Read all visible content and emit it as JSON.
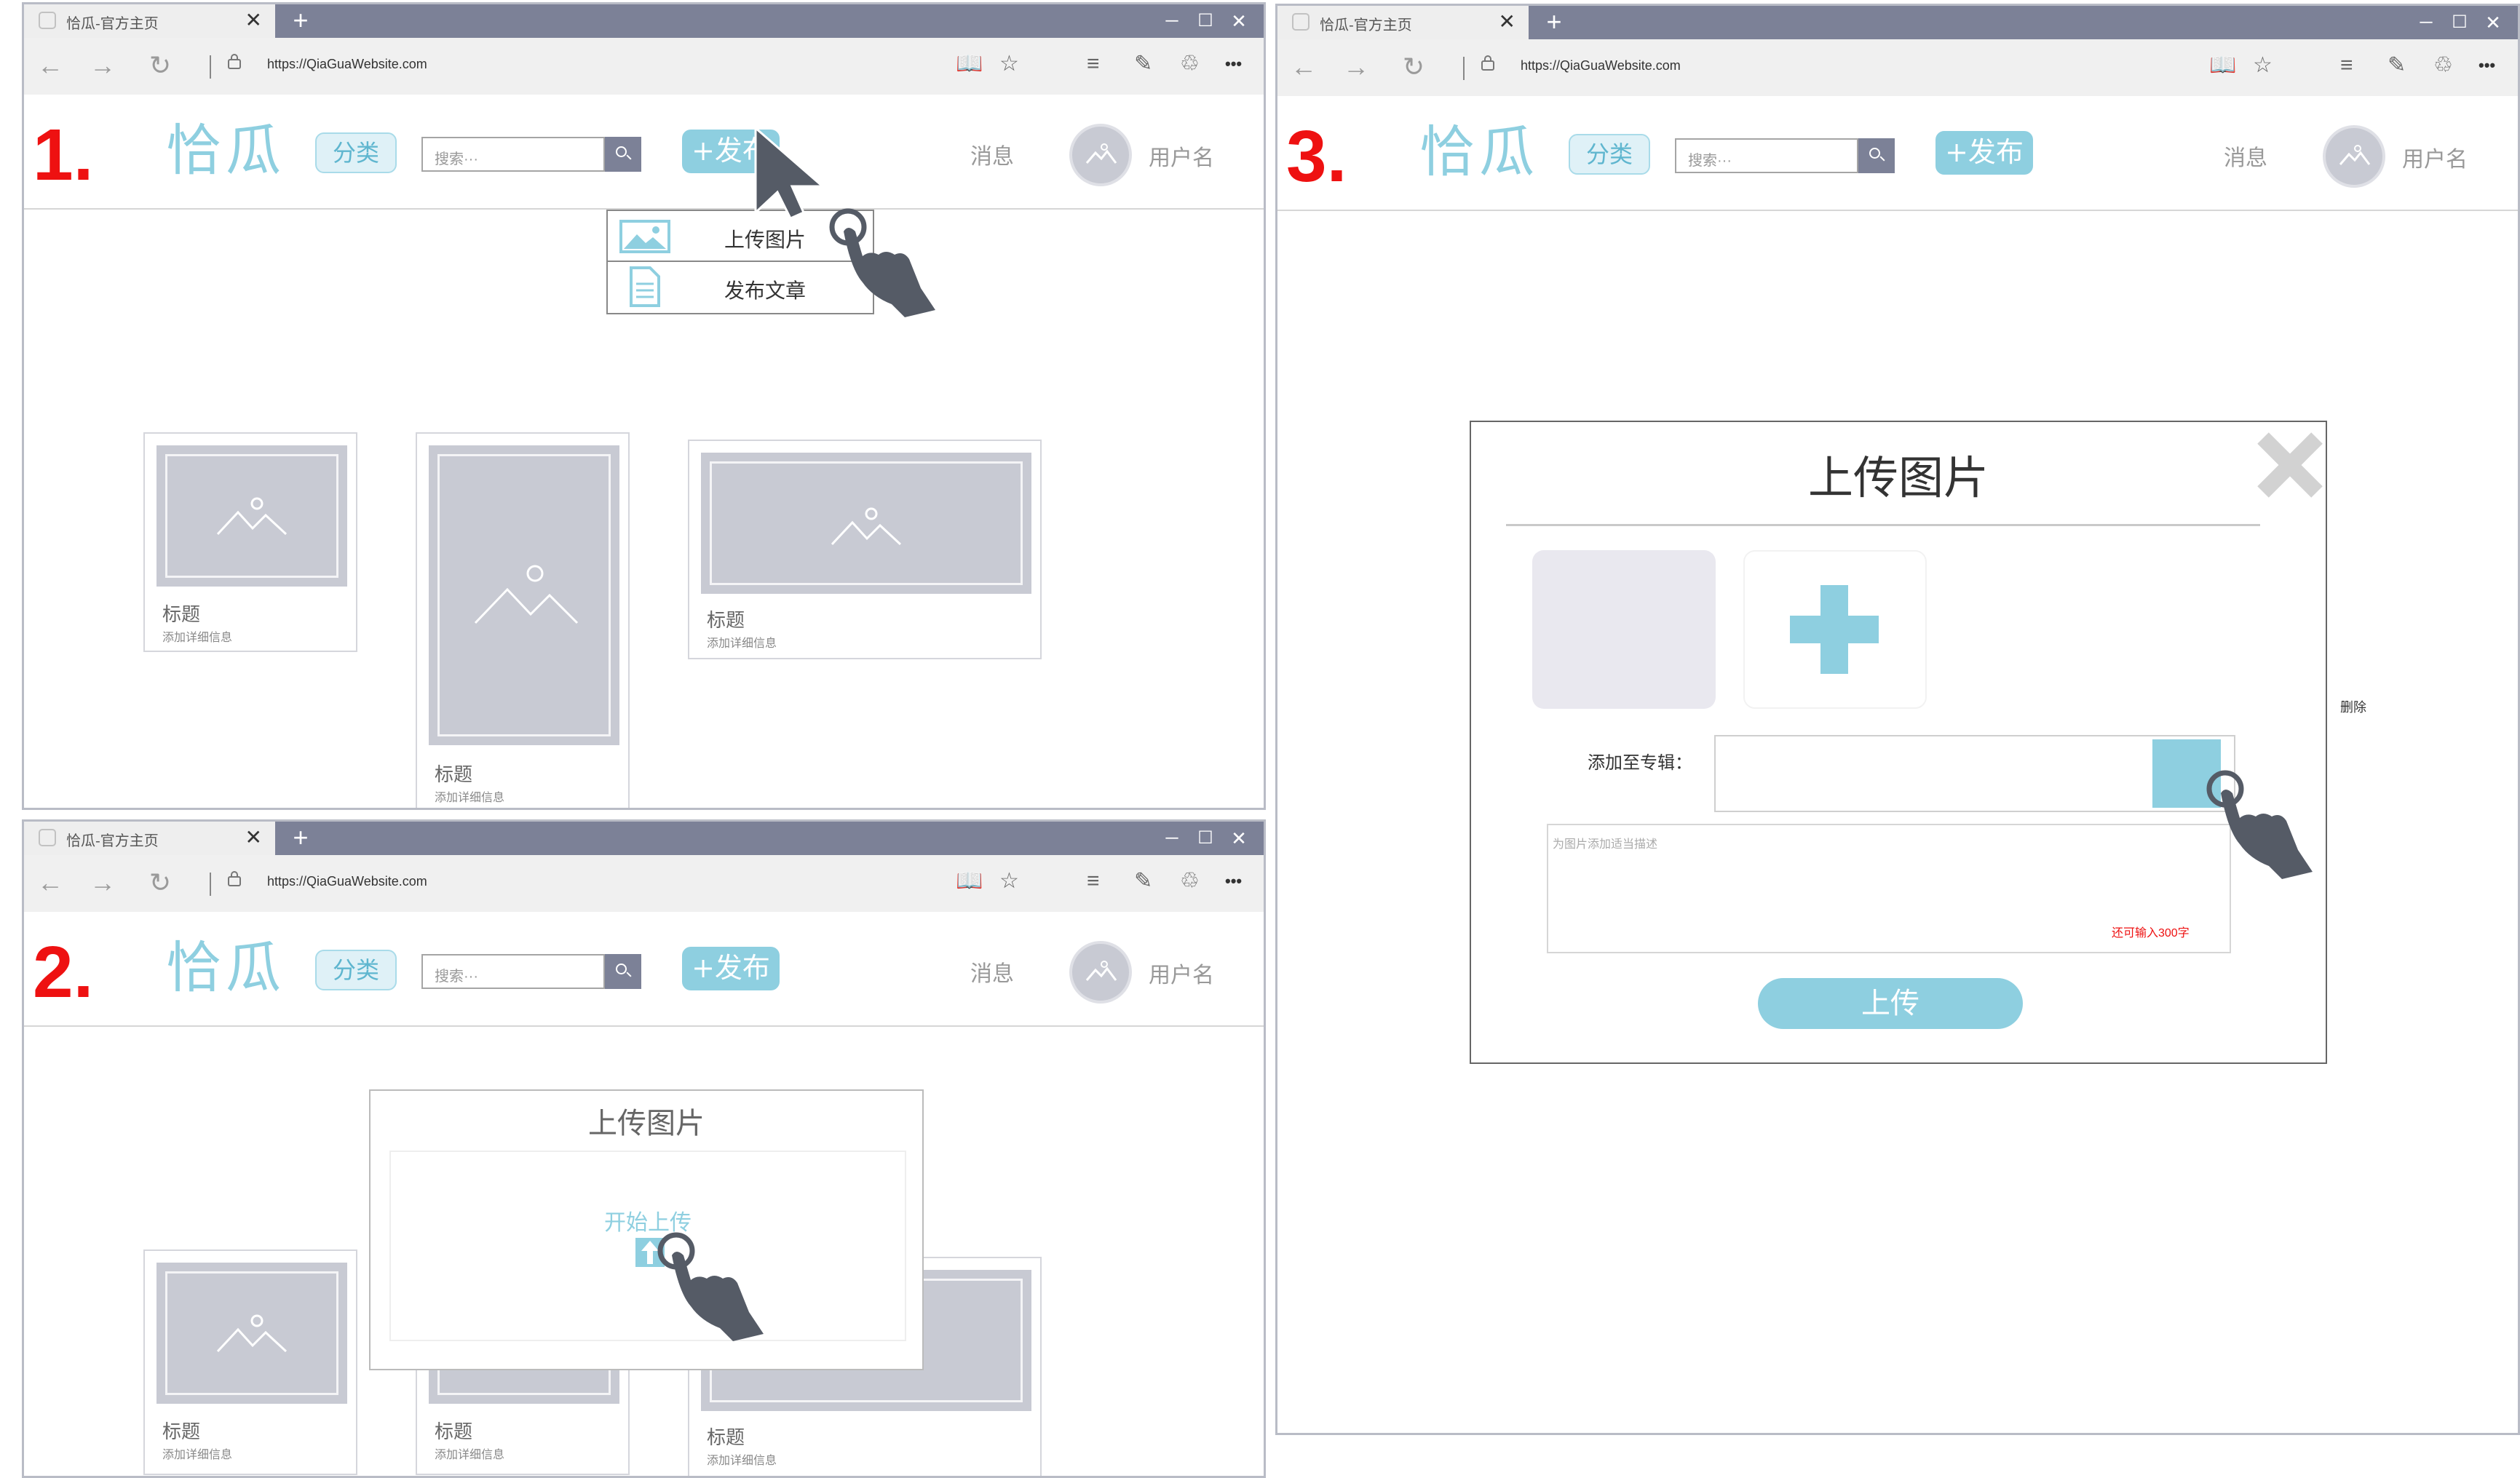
{
  "browser": {
    "tab_title": "恰瓜-官方主页",
    "tab_close": "✕",
    "new_tab": "+",
    "win_min": "─",
    "win_max": "☐",
    "win_close": "✕",
    "url": "https://QiaGuaWebsite.com",
    "nav_back": "←",
    "nav_forward": "→",
    "nav_refresh": "↻",
    "tool_read": "📖",
    "tool_fav": "☆",
    "tool_hub": "≡",
    "tool_note": "✎",
    "tool_share": "♲",
    "tool_more": "•••"
  },
  "site": {
    "logo": "恰瓜",
    "category": "分类",
    "search_placeholder": "搜索···",
    "publish": "+发布",
    "messages": "消息",
    "username": "用户名"
  },
  "steps": {
    "one": "1.",
    "two": "2.",
    "three": "3."
  },
  "cards": {
    "title": "标题",
    "subtitle": "添加详细信息"
  },
  "dropdown": {
    "upload_image": "上传图片",
    "publish_article": "发布文章"
  },
  "upload_dialog_small": {
    "title": "上传图片",
    "start_upload": "开始上传"
  },
  "upload_dialog": {
    "title": "上传图片",
    "close_icon": "✕",
    "add_to_album_label": "添加至专辑：",
    "description_placeholder": "为图片添加适当描述",
    "char_limit": "还可输入300字",
    "upload_button": "上传",
    "delete_label": "删除"
  },
  "colors": {
    "accent": "#8ecfe0",
    "tabbar": "#7c8197",
    "step": "#ee1111",
    "placeholder_img": "#c8cad3"
  }
}
